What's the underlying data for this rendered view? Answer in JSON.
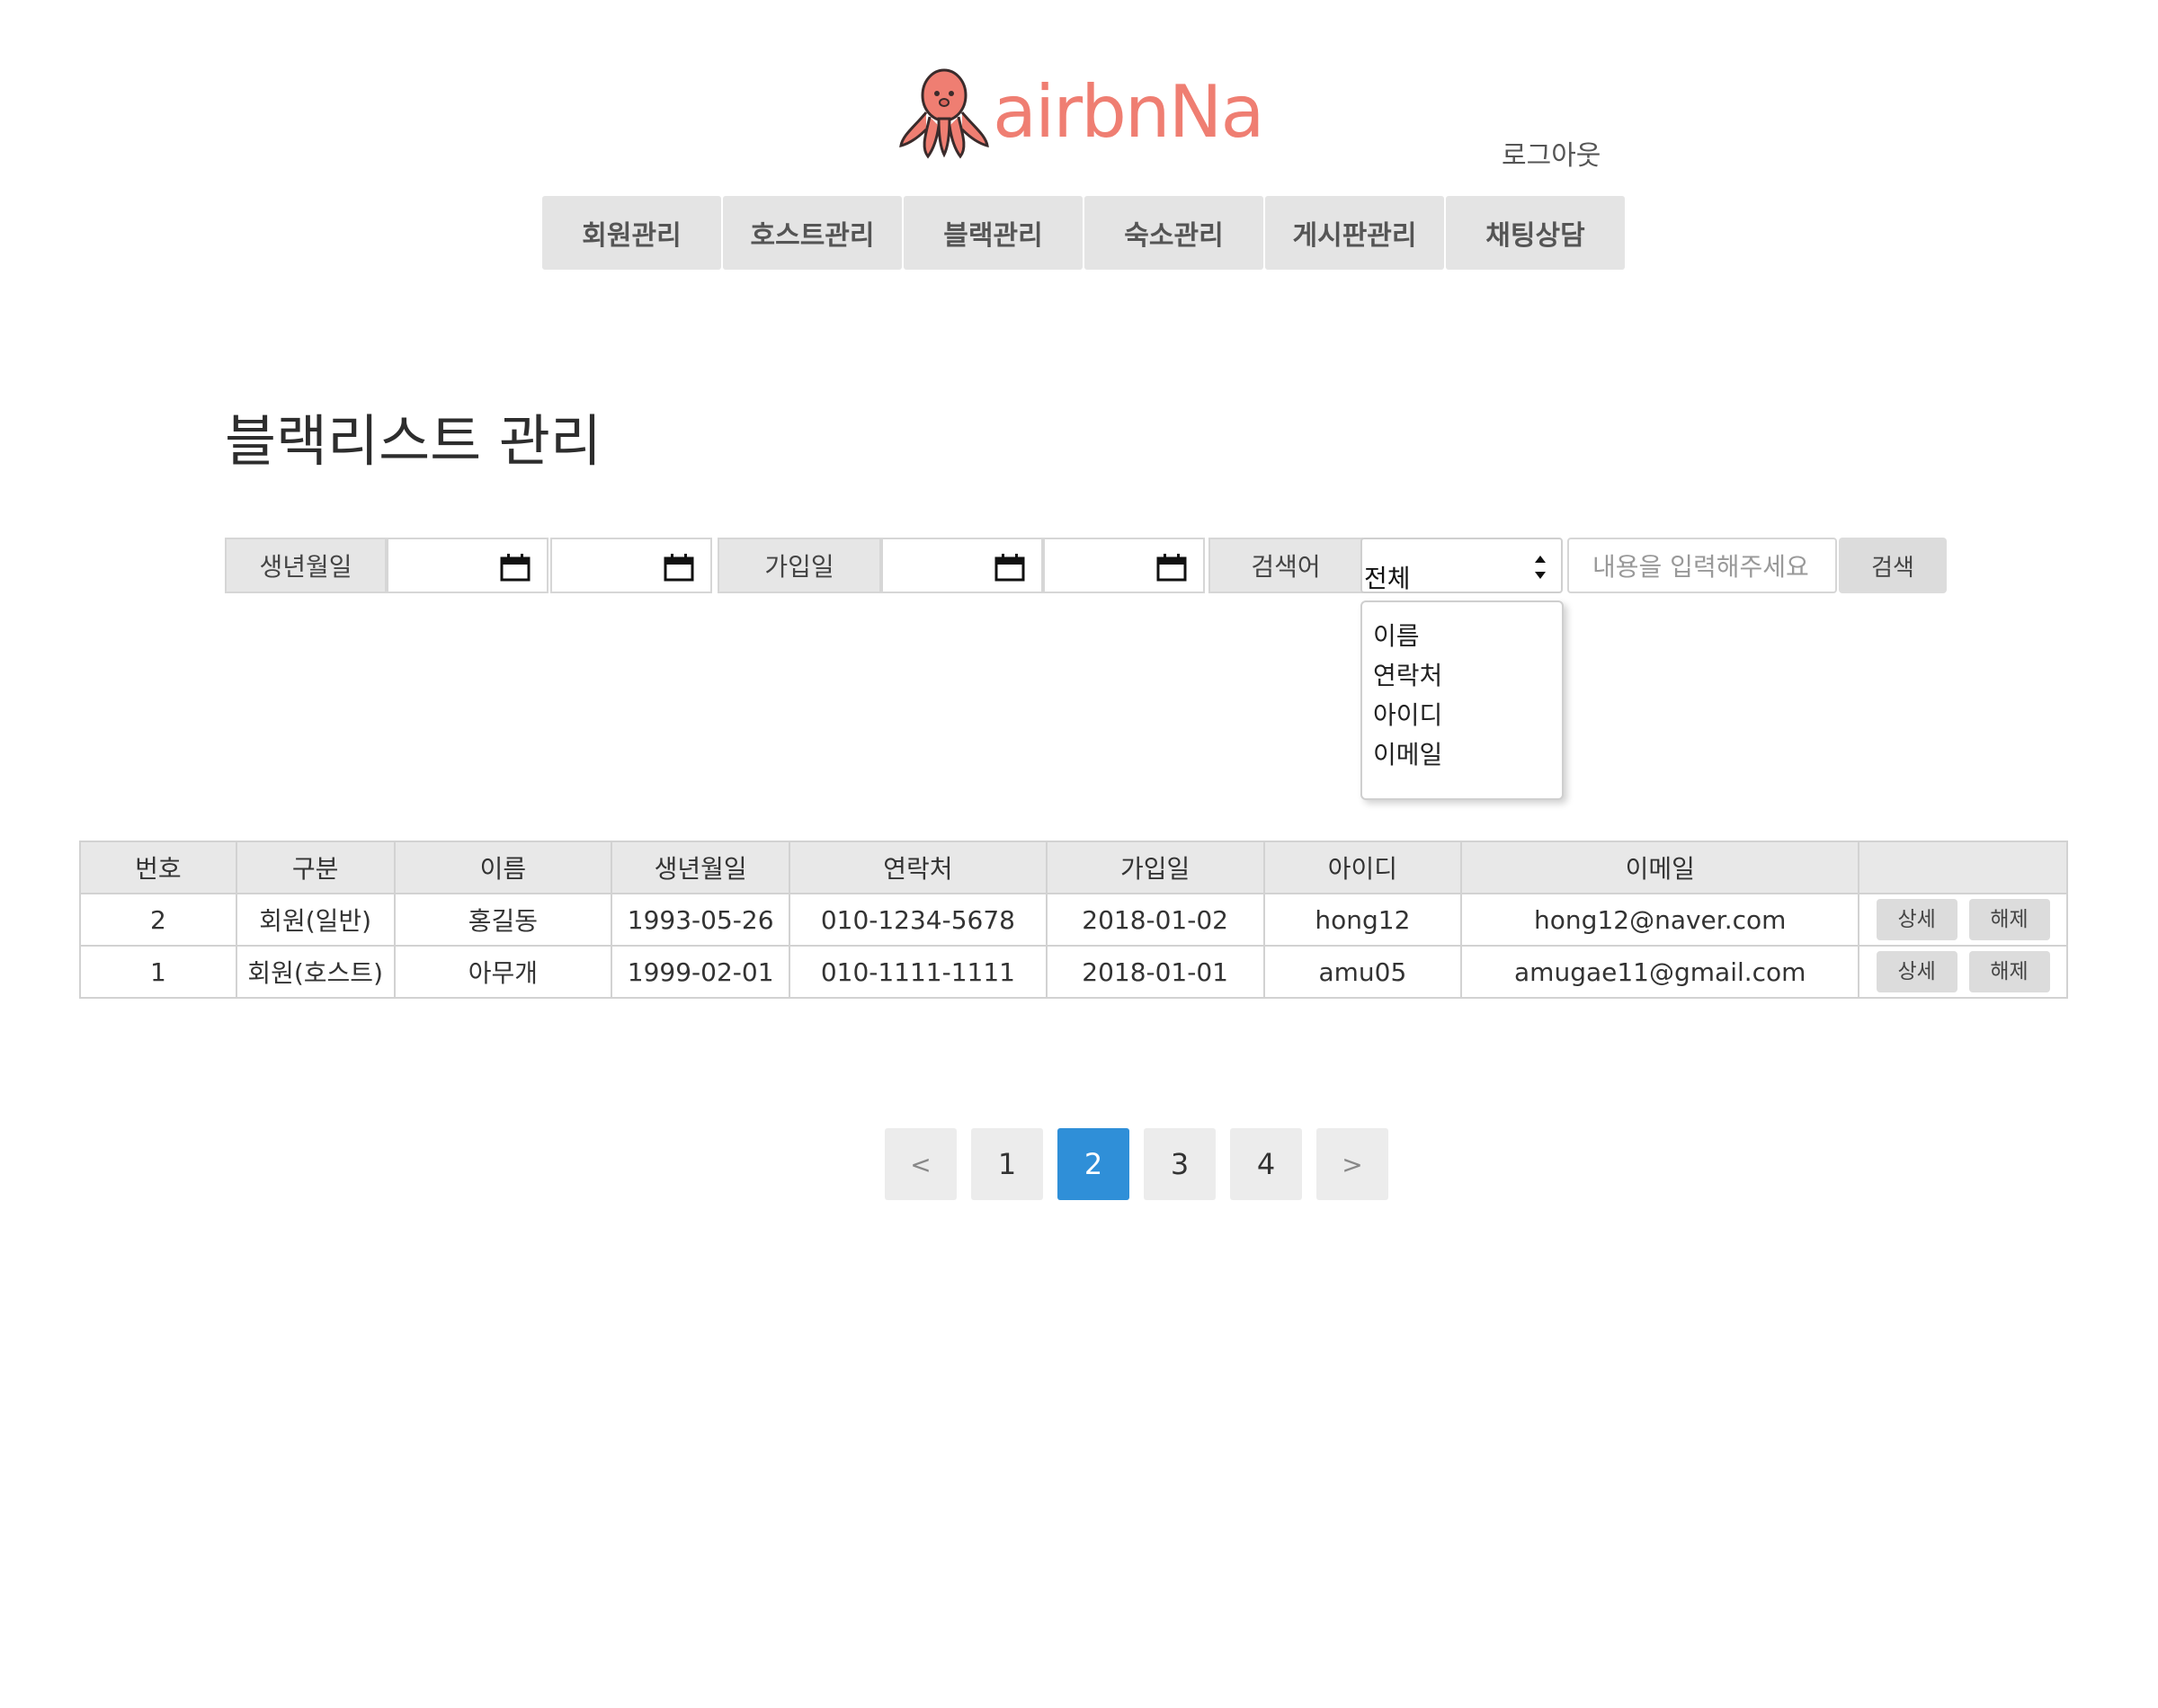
{
  "header": {
    "logo_text": "airbnNa",
    "logout_label": "로그아웃",
    "brand_color": "#ef7e72",
    "nav": [
      "회원관리",
      "호스트관리",
      "블랙관리",
      "숙소관리",
      "게시판관리",
      "채팅상담"
    ]
  },
  "page": {
    "title": "블랙리스트 관리"
  },
  "search": {
    "birth_label": "생년월일",
    "join_label": "가입일",
    "keyword_label": "검색어",
    "select_value": "전체",
    "select_options": [
      "이름",
      "연락처",
      "아이디",
      "이메일"
    ],
    "input_placeholder": "내용을 입력해주세요",
    "button_label": "검색"
  },
  "table": {
    "headers": [
      "번호",
      "구분",
      "이름",
      "생년월일",
      "연락처",
      "가입일",
      "아이디",
      "이메일",
      ""
    ],
    "rows": [
      {
        "no": "2",
        "type": "회원(일반)",
        "name": "홍길동",
        "birth": "1993-05-26",
        "phone": "010-1234-5678",
        "joined": "2018-01-02",
        "id": "hong12",
        "email": "hong12@naver.com",
        "detail": "상세",
        "release": "해제"
      },
      {
        "no": "1",
        "type": "회원(호스트)",
        "name": "아무개",
        "birth": "1999-02-01",
        "phone": "010-1111-1111",
        "joined": "2018-01-01",
        "id": "amu05",
        "email": "amugae11@gmail.com",
        "detail": "상세",
        "release": "해제"
      }
    ]
  },
  "pagination": {
    "prev": "<",
    "pages": [
      "1",
      "2",
      "3",
      "4"
    ],
    "current": "2",
    "next": ">",
    "active_color": "#2f8fd8"
  }
}
